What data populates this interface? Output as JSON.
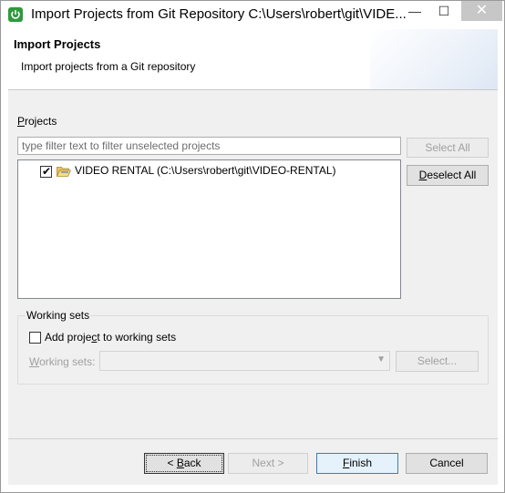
{
  "window": {
    "title": "Import Projects from Git Repository C:\\Users\\robert\\git\\VIDE...",
    "minimize_glyph": "—",
    "maximize_glyph": "☐",
    "close_glyph": "✕"
  },
  "header": {
    "title": "Import Projects",
    "description": "Import projects from a Git repository"
  },
  "projects": {
    "label": "Projects",
    "filter_placeholder": "type filter text to filter unselected projects",
    "select_all_label": "Select All",
    "deselect_all_label": "Deselect All",
    "items": [
      {
        "label": "VIDEO RENTAL (C:\\Users\\robert\\git\\VIDEO-RENTAL)",
        "checked": true,
        "icon": "open-folder-icon"
      }
    ]
  },
  "working_sets": {
    "group_label": "Working sets",
    "add_label": "Add project to working sets",
    "add_checked": false,
    "sets_label": "Working sets:",
    "sets_value": "",
    "select_label": "Select..."
  },
  "footer": {
    "back_label": "< Back",
    "next_label": "Next >",
    "finish_label": "Finish",
    "cancel_label": "Cancel"
  },
  "colors": {
    "app_icon": "#2f9a3a",
    "finish_border": "#3c7fb1",
    "dialog_bg": "#f0f0f0"
  }
}
